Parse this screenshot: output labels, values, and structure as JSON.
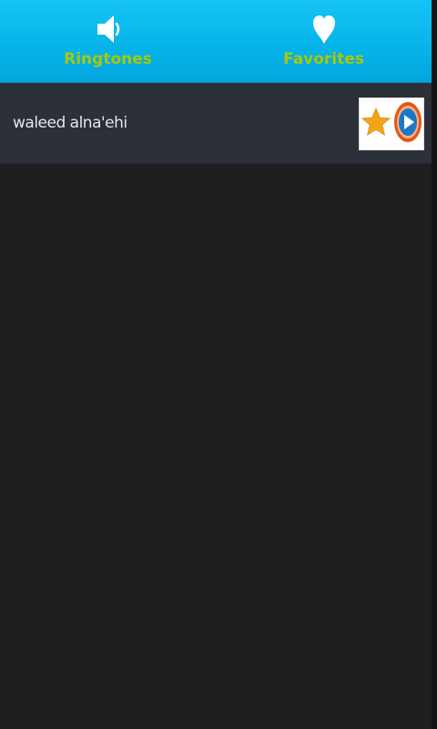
{
  "tabs": [
    {
      "label": "Ringtones",
      "icon": "speaker-icon"
    },
    {
      "label": "Favorites",
      "icon": "heart-icon"
    }
  ],
  "list": {
    "items": [
      {
        "title": "waleed alna'ehi",
        "actions": [
          "star-icon",
          "play-icon"
        ]
      }
    ]
  },
  "colors": {
    "tab_bar": "#06b3e8",
    "tab_label": "#a9c70e",
    "list_item_bg": "#2c3038",
    "screen_bg": "#1e1e1f",
    "star": "#f2a516",
    "play_ring": "#e2561b",
    "play_center": "#1b78c9"
  }
}
